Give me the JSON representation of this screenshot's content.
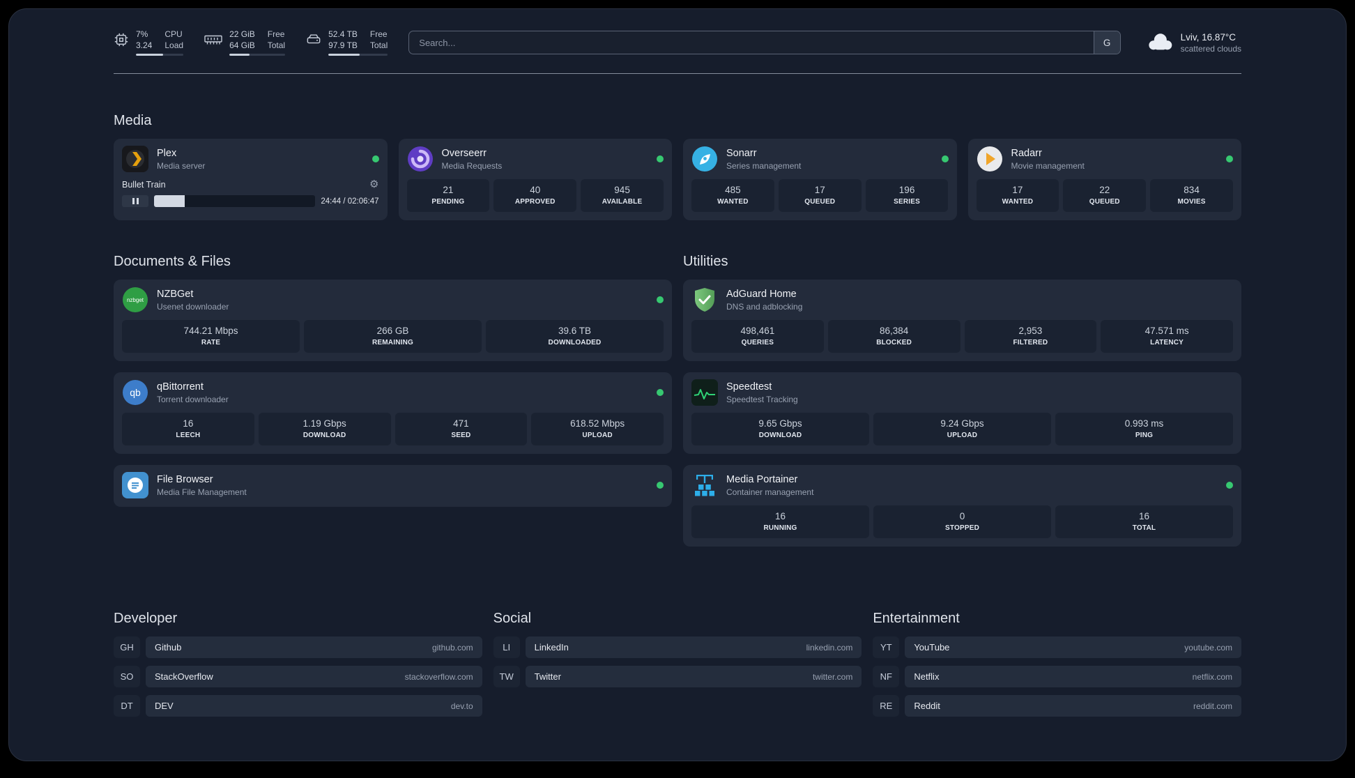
{
  "colors": {
    "status_online": "#37c871"
  },
  "topbar": {
    "cpu": {
      "line1": "7%",
      "line2": "3.24",
      "label1": "CPU",
      "label2": "Load",
      "progress_pct": 58
    },
    "memory": {
      "line1": "22 GiB",
      "line2": "64 GiB",
      "label1": "Free",
      "label2": "Total",
      "progress_pct": 36
    },
    "disk": {
      "line1": "52.4 TB",
      "line2": "97.9 TB",
      "label1": "Free",
      "label2": "Total",
      "progress_pct": 53
    },
    "search": {
      "placeholder": "Search...",
      "provider": "G"
    },
    "weather": {
      "location": "Lviv, 16.87°C",
      "condition": "scattered clouds"
    }
  },
  "groups": {
    "media": {
      "title": "Media",
      "plex": {
        "name": "Plex",
        "subtitle": "Media server",
        "player": {
          "title": "Bullet Train",
          "time": "24:44 / 02:06:47",
          "progress_pct": 19
        }
      },
      "overseerr": {
        "name": "Overseerr",
        "subtitle": "Media Requests",
        "stats": [
          {
            "value": "21",
            "label": "PENDING"
          },
          {
            "value": "40",
            "label": "APPROVED"
          },
          {
            "value": "945",
            "label": "AVAILABLE"
          }
        ]
      },
      "sonarr": {
        "name": "Sonarr",
        "subtitle": "Series management",
        "stats": [
          {
            "value": "485",
            "label": "WANTED"
          },
          {
            "value": "17",
            "label": "QUEUED"
          },
          {
            "value": "196",
            "label": "SERIES"
          }
        ]
      },
      "radarr": {
        "name": "Radarr",
        "subtitle": "Movie management",
        "stats": [
          {
            "value": "17",
            "label": "WANTED"
          },
          {
            "value": "22",
            "label": "QUEUED"
          },
          {
            "value": "834",
            "label": "MOVIES"
          }
        ]
      }
    },
    "documents": {
      "title": "Documents & Files",
      "nzbget": {
        "name": "NZBGet",
        "subtitle": "Usenet downloader",
        "stats": [
          {
            "value": "744.21 Mbps",
            "label": "RATE"
          },
          {
            "value": "266 GB",
            "label": "REMAINING"
          },
          {
            "value": "39.6 TB",
            "label": "DOWNLOADED"
          }
        ]
      },
      "qbittorrent": {
        "name": "qBittorrent",
        "subtitle": "Torrent downloader",
        "stats": [
          {
            "value": "16",
            "label": "LEECH"
          },
          {
            "value": "1.19 Gbps",
            "label": "DOWNLOAD"
          },
          {
            "value": "471",
            "label": "SEED"
          },
          {
            "value": "618.52 Mbps",
            "label": "UPLOAD"
          }
        ]
      },
      "filebrowser": {
        "name": "File Browser",
        "subtitle": "Media File Management"
      }
    },
    "utilities": {
      "title": "Utilities",
      "adguard": {
        "name": "AdGuard Home",
        "subtitle": "DNS and adblocking",
        "stats": [
          {
            "value": "498,461",
            "label": "QUERIES"
          },
          {
            "value": "86,384",
            "label": "BLOCKED"
          },
          {
            "value": "2,953",
            "label": "FILTERED"
          },
          {
            "value": "47.571 ms",
            "label": "LATENCY"
          }
        ]
      },
      "speedtest": {
        "name": "Speedtest",
        "subtitle": "Speedtest Tracking",
        "stats": [
          {
            "value": "9.65 Gbps",
            "label": "DOWNLOAD"
          },
          {
            "value": "9.24 Gbps",
            "label": "UPLOAD"
          },
          {
            "value": "0.993 ms",
            "label": "PING"
          }
        ]
      },
      "portainer": {
        "name": "Media Portainer",
        "subtitle": "Container management",
        "stats": [
          {
            "value": "16",
            "label": "RUNNING"
          },
          {
            "value": "0",
            "label": "STOPPED"
          },
          {
            "value": "16",
            "label": "TOTAL"
          }
        ]
      }
    }
  },
  "bookmarks": {
    "developer": {
      "title": "Developer",
      "items": [
        {
          "abbr": "GH",
          "name": "Github",
          "url": "github.com"
        },
        {
          "abbr": "SO",
          "name": "StackOverflow",
          "url": "stackoverflow.com"
        },
        {
          "abbr": "DT",
          "name": "DEV",
          "url": "dev.to"
        }
      ]
    },
    "social": {
      "title": "Social",
      "items": [
        {
          "abbr": "LI",
          "name": "LinkedIn",
          "url": "linkedin.com"
        },
        {
          "abbr": "TW",
          "name": "Twitter",
          "url": "twitter.com"
        }
      ]
    },
    "entertainment": {
      "title": "Entertainment",
      "items": [
        {
          "abbr": "YT",
          "name": "YouTube",
          "url": "youtube.com"
        },
        {
          "abbr": "NF",
          "name": "Netflix",
          "url": "netflix.com"
        },
        {
          "abbr": "RE",
          "name": "Reddit",
          "url": "reddit.com"
        }
      ]
    }
  }
}
